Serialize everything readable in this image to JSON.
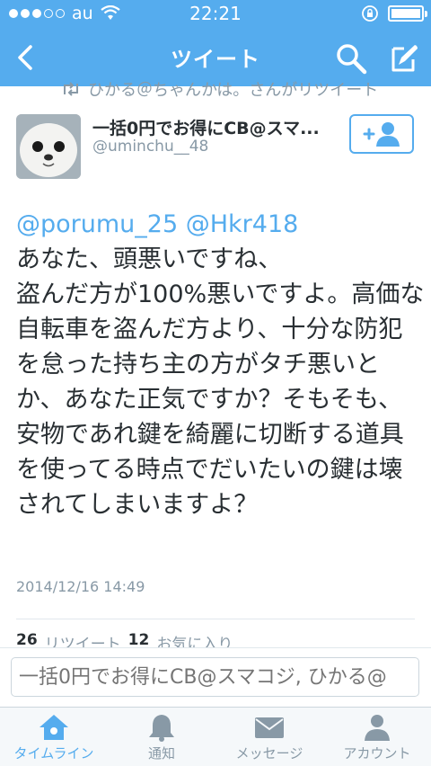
{
  "status_bar": {
    "carrier": "au",
    "time": "22:21"
  },
  "nav": {
    "title": "ツイート"
  },
  "retweet": {
    "text": "ひかる＠ちゃんかは。さんがリツイート"
  },
  "user": {
    "name": "一括0円でお得にCB@スマ...",
    "handle": "@uminchu__48"
  },
  "tweet": {
    "mention1": "@porumu_25",
    "mention2": "@Hkr418",
    "text": "あなた、頭悪いですね、\n盗んだ方が100%悪いですよ。高価な自転車を盗んだ方より、十分な防犯を怠った持ち主の方がタチ悪いとか、あなた正気ですか？そもそも、安物であれ鍵を綺麗に切断する道具を使ってる時点でだいたいの鍵は壊されてしまいますよ？",
    "date": "2014/12/16 14:49"
  },
  "stats": {
    "retweets": "26",
    "retweets_label": "リツイート",
    "favorites": "12",
    "favorites_label": "お気に入り"
  },
  "reply": {
    "placeholder": "一括0円でお得にCB@スマコジ, ひかる@"
  },
  "tabs": [
    {
      "label": "タイムライン"
    },
    {
      "label": "通知"
    },
    {
      "label": "メッセージ"
    },
    {
      "label": "アカウント"
    }
  ],
  "colors": {
    "accent": "#55acee",
    "text": "#292f33",
    "muted": "#8899a6"
  }
}
